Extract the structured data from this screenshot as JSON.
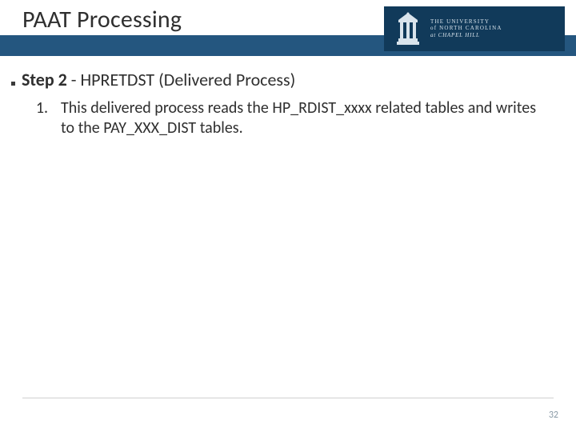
{
  "header": {
    "title": "PAAT Processing",
    "logo": {
      "line1": "THE UNIVERSITY",
      "line2": "of NORTH CAROLINA",
      "line3": "at CHAPEL HILL"
    }
  },
  "body": {
    "bullet_prefix": "Step 2",
    "bullet_sep": " - ",
    "bullet_rest": "HPRETDST (Delivered Process)",
    "items": [
      {
        "marker": "1.",
        "text": "This delivered process reads the HP_RDIST_xxxx related tables and writes to the PAY_XXX_DIST tables."
      }
    ]
  },
  "footer": {
    "page_number": "32"
  }
}
